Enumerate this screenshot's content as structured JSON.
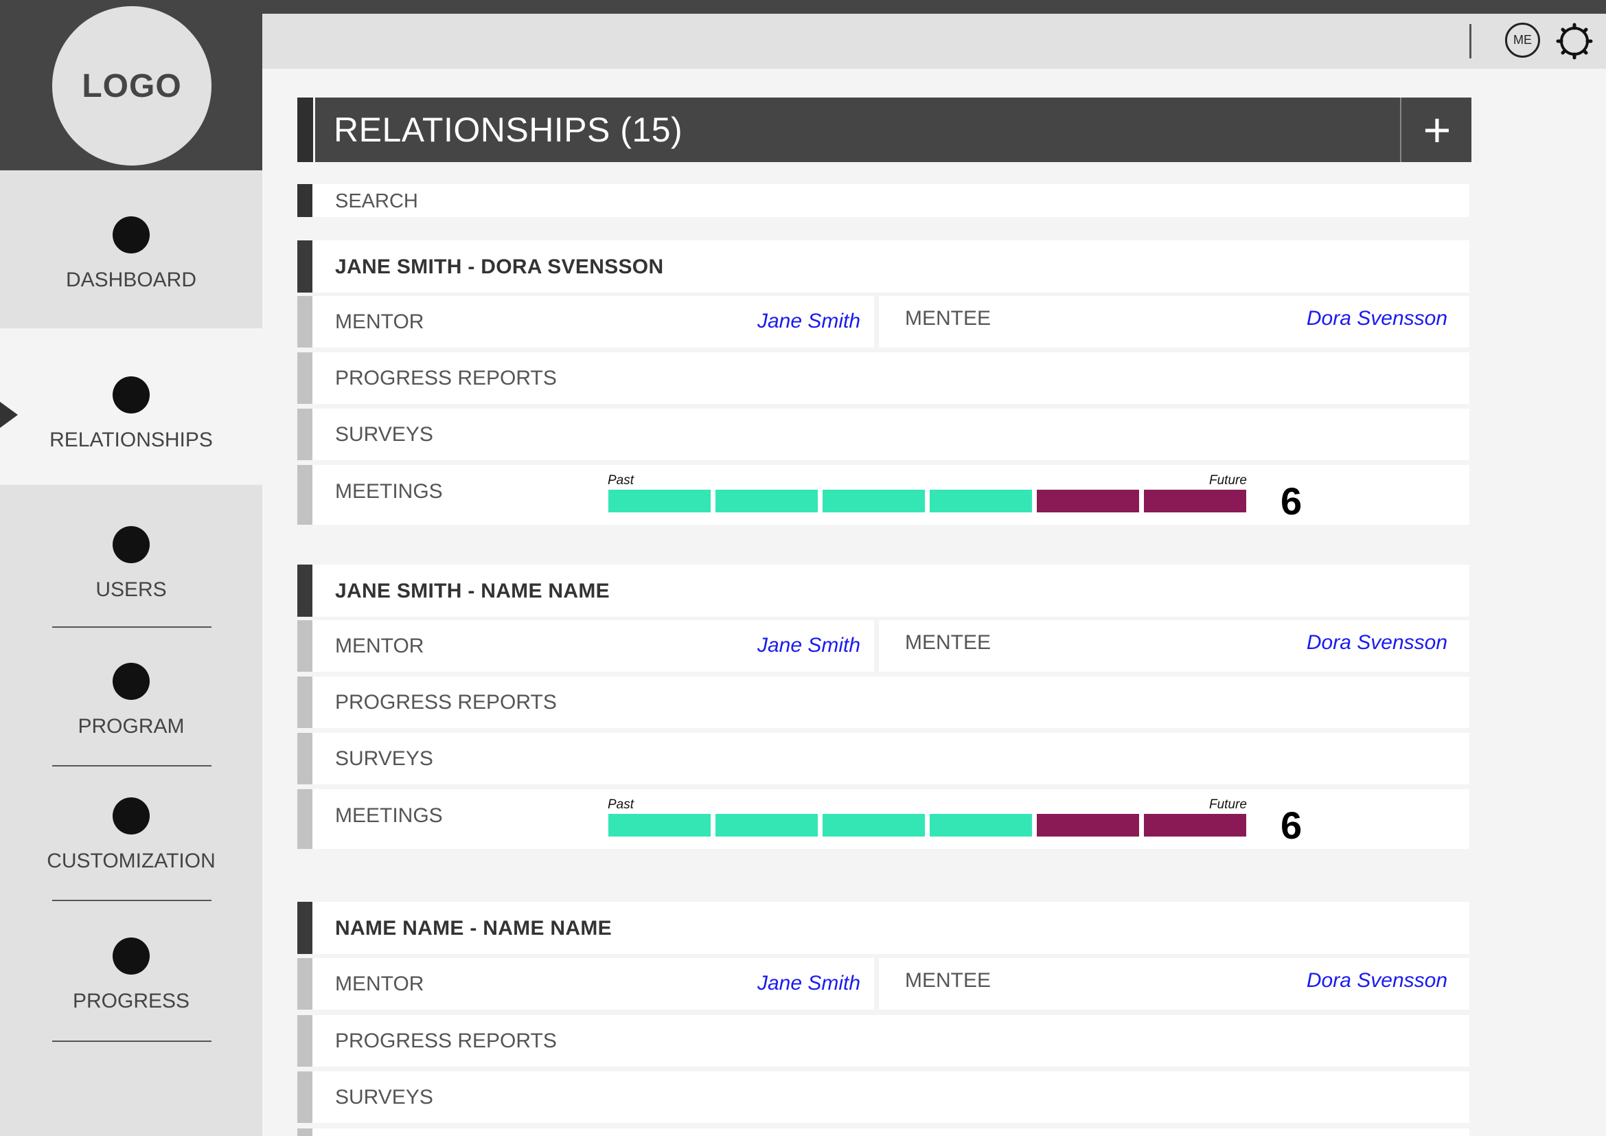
{
  "logo": {
    "text": "LOGO"
  },
  "header": {
    "avatar_text": "ME"
  },
  "sidebar": {
    "items": [
      {
        "label": "DASHBOARD",
        "icon": "circle-icon"
      },
      {
        "label": "RELATIONSHIPS",
        "icon": "circle-icon",
        "active": true
      },
      {
        "label": "USERS",
        "icon": "circle-icon"
      },
      {
        "label": "PROGRAM",
        "icon": "circle-icon"
      },
      {
        "label": "CUSTOMIZATION",
        "icon": "circle-icon"
      },
      {
        "label": "PROGRESS",
        "icon": "circle-icon"
      }
    ]
  },
  "main": {
    "title": "RELATIONSHIPS (15)",
    "add_label": "+",
    "search_label": "SEARCH",
    "labels": {
      "mentor": "MENTOR",
      "mentee": "MENTEE",
      "progress_reports": "PROGRESS REPORTS",
      "surveys": "SURVEYS",
      "meetings": "MEETINGS",
      "past": "Past",
      "future": "Future"
    },
    "relationships": [
      {
        "title": "JANE SMITH - DORA SVENSSON",
        "mentor": "Jane Smith",
        "mentee": "Dora Svensson",
        "meetings_past": 4,
        "meetings_future": 2,
        "meetings_count": "6"
      },
      {
        "title": "JANE SMITH - NAME NAME",
        "mentor": "Jane Smith",
        "mentee": "Dora Svensson",
        "meetings_past": 4,
        "meetings_future": 2,
        "meetings_count": "6"
      },
      {
        "title": "NAME NAME - NAME NAME",
        "mentor": "Jane Smith",
        "mentee": "Dora Svensson"
      }
    ]
  },
  "colors": {
    "dark": "#454545",
    "panel": "#e1e1e1",
    "past_meeting": "#33e6b4",
    "future_meeting": "#8a1a55",
    "link": "#1a1af0"
  }
}
